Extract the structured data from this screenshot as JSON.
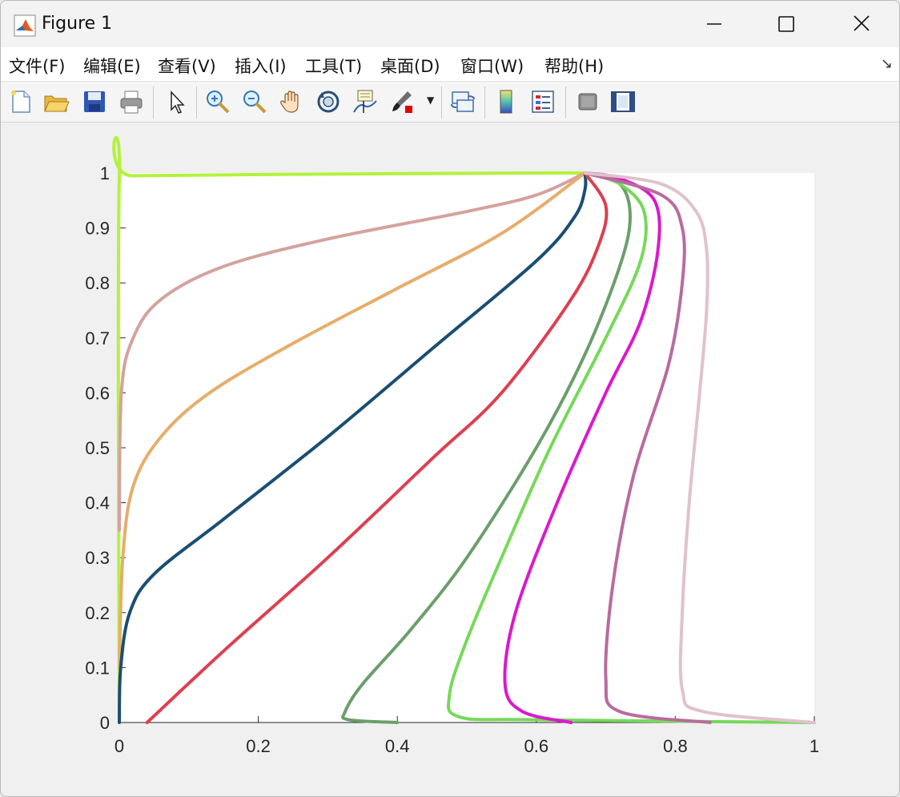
{
  "window": {
    "title": "Figure 1"
  },
  "menu": {
    "items": [
      "文件(F)",
      "编辑(E)",
      "查看(V)",
      "插入(I)",
      "工具(T)",
      "桌面(D)",
      "窗口(W)",
      "帮助(H)"
    ]
  },
  "toolbar": {
    "buttons": [
      "new-figure-icon",
      "open-file-icon",
      "save-icon",
      "print-icon",
      "pointer-icon",
      "zoom-in-icon",
      "zoom-out-icon",
      "pan-hand-icon",
      "rotate-3d-icon",
      "data-cursor-icon",
      "brush-icon",
      "link-plot-icon",
      "colorbar-icon",
      "legend-icon",
      "hide-plot-tools-icon",
      "show-plot-tools-icon"
    ]
  },
  "chart_data": {
    "type": "line",
    "title": "",
    "xlabel": "",
    "ylabel": "",
    "xlim": [
      0,
      1
    ],
    "ylim": [
      0,
      1
    ],
    "xticks": [
      "0",
      "0.2",
      "0.4",
      "0.6",
      "0.8",
      "1"
    ],
    "yticks": [
      "0",
      "0.1",
      "0.2",
      "0.3",
      "0.4",
      "0.5",
      "0.6",
      "0.7",
      "0.8",
      "0.9",
      "1"
    ],
    "grid": false,
    "series": [
      {
        "color": "#b3f23b",
        "points": [
          [
            0,
            0
          ],
          [
            0,
            0.99
          ],
          [
            0.02,
            0.995
          ],
          [
            0.3,
            0.998
          ],
          [
            0.6,
            1.0
          ],
          [
            0.67,
            1.0
          ]
        ]
      },
      {
        "color": "#d4a29e",
        "points": [
          [
            0,
            0.35
          ],
          [
            0.003,
            0.6
          ],
          [
            0.02,
            0.7
          ],
          [
            0.06,
            0.77
          ],
          [
            0.15,
            0.83
          ],
          [
            0.3,
            0.88
          ],
          [
            0.5,
            0.93
          ],
          [
            0.6,
            0.96
          ],
          [
            0.67,
            1.0
          ]
        ]
      },
      {
        "color": "#e6ad6b",
        "points": [
          [
            0,
            0.1
          ],
          [
            0.005,
            0.3
          ],
          [
            0.02,
            0.43
          ],
          [
            0.06,
            0.52
          ],
          [
            0.13,
            0.6
          ],
          [
            0.25,
            0.69
          ],
          [
            0.4,
            0.79
          ],
          [
            0.55,
            0.89
          ],
          [
            0.67,
            1.0
          ]
        ]
      },
      {
        "color": "#1a4e73",
        "points": [
          [
            0,
            0
          ],
          [
            0.002,
            0.1
          ],
          [
            0.015,
            0.2
          ],
          [
            0.05,
            0.27
          ],
          [
            0.15,
            0.37
          ],
          [
            0.3,
            0.52
          ],
          [
            0.45,
            0.68
          ],
          [
            0.6,
            0.84
          ],
          [
            0.655,
            0.92
          ],
          [
            0.67,
            0.97
          ],
          [
            0.67,
            1.0
          ]
        ]
      },
      {
        "color": "#dc4050",
        "points": [
          [
            0.04,
            0
          ],
          [
            0.15,
            0.13
          ],
          [
            0.3,
            0.3
          ],
          [
            0.45,
            0.48
          ],
          [
            0.55,
            0.6
          ],
          [
            0.65,
            0.77
          ],
          [
            0.69,
            0.87
          ],
          [
            0.7,
            0.94
          ],
          [
            0.67,
            1.0
          ]
        ]
      },
      {
        "color": "#6b9e6b",
        "points": [
          [
            0.4,
            0
          ],
          [
            0.33,
            0.005
          ],
          [
            0.325,
            0.02
          ],
          [
            0.35,
            0.07
          ],
          [
            0.42,
            0.17
          ],
          [
            0.5,
            0.3
          ],
          [
            0.6,
            0.5
          ],
          [
            0.67,
            0.67
          ],
          [
            0.72,
            0.83
          ],
          [
            0.735,
            0.92
          ],
          [
            0.72,
            0.98
          ],
          [
            0.67,
            1.0
          ]
        ]
      },
      {
        "color": "#76d95a",
        "points": [
          [
            1,
            0
          ],
          [
            0.6,
            0.005
          ],
          [
            0.49,
            0.01
          ],
          [
            0.475,
            0.05
          ],
          [
            0.5,
            0.15
          ],
          [
            0.55,
            0.3
          ],
          [
            0.62,
            0.5
          ],
          [
            0.7,
            0.7
          ],
          [
            0.75,
            0.84
          ],
          [
            0.755,
            0.93
          ],
          [
            0.72,
            0.98
          ],
          [
            0.67,
            1.0
          ]
        ]
      },
      {
        "color": "#d91acc",
        "points": [
          [
            0.65,
            0
          ],
          [
            0.58,
            0.02
          ],
          [
            0.555,
            0.07
          ],
          [
            0.57,
            0.2
          ],
          [
            0.63,
            0.4
          ],
          [
            0.7,
            0.6
          ],
          [
            0.75,
            0.73
          ],
          [
            0.775,
            0.86
          ],
          [
            0.77,
            0.95
          ],
          [
            0.72,
            0.99
          ],
          [
            0.67,
            1.0
          ]
        ]
      },
      {
        "color": "#b86b9e",
        "points": [
          [
            0.85,
            0
          ],
          [
            0.72,
            0.02
          ],
          [
            0.7,
            0.08
          ],
          [
            0.71,
            0.25
          ],
          [
            0.74,
            0.45
          ],
          [
            0.79,
            0.65
          ],
          [
            0.81,
            0.8
          ],
          [
            0.81,
            0.9
          ],
          [
            0.78,
            0.96
          ],
          [
            0.67,
            1.0
          ]
        ]
      },
      {
        "color": "#e0c2cc",
        "points": [
          [
            1,
            0
          ],
          [
            0.84,
            0.02
          ],
          [
            0.81,
            0.06
          ],
          [
            0.81,
            0.2
          ],
          [
            0.82,
            0.4
          ],
          [
            0.835,
            0.6
          ],
          [
            0.845,
            0.75
          ],
          [
            0.845,
            0.86
          ],
          [
            0.83,
            0.93
          ],
          [
            0.78,
            0.98
          ],
          [
            0.67,
            1.0
          ]
        ]
      }
    ]
  }
}
